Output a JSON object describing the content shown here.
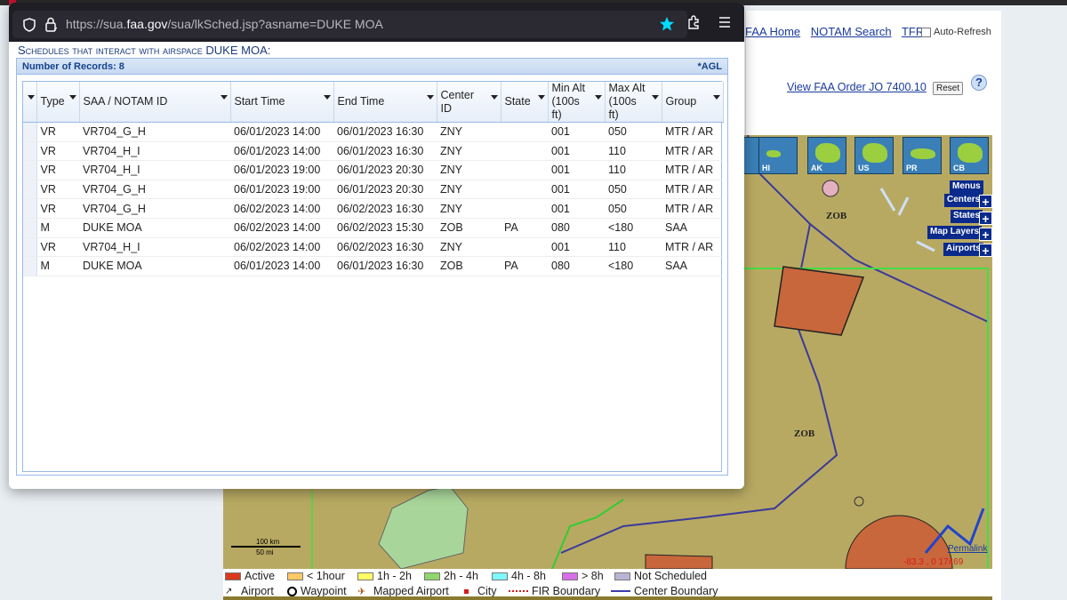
{
  "browser": {
    "url_prefix": "https://sua.",
    "url_domain": "faa.gov",
    "url_suffix": "/sua/lkSched.jsp?asname=DUKE MOA"
  },
  "popup": {
    "heading": "Schedules that interact with airspace DUKE MOA:",
    "record_count_label": "Number of Records: 8",
    "agl_label": "*AGL",
    "columns": [
      "Type",
      "SAA / NOTAM ID",
      "Start Time",
      "End Time",
      "Center ID",
      "State",
      "Min Alt (100s ft)",
      "Max Alt (100s ft)",
      "Group"
    ],
    "rows": [
      [
        "VR",
        "VR704_G_H",
        "06/01/2023 14:00",
        "06/01/2023 16:30",
        "ZNY",
        "",
        "001",
        "050",
        "MTR / AR"
      ],
      [
        "VR",
        "VR704_H_I",
        "06/01/2023 14:00",
        "06/01/2023 16:30",
        "ZNY",
        "",
        "001",
        "110",
        "MTR / AR"
      ],
      [
        "VR",
        "VR704_H_I",
        "06/01/2023 19:00",
        "06/01/2023 20:30",
        "ZNY",
        "",
        "001",
        "110",
        "MTR / AR"
      ],
      [
        "VR",
        "VR704_G_H",
        "06/01/2023 19:00",
        "06/01/2023 20:30",
        "ZNY",
        "",
        "001",
        "050",
        "MTR / AR"
      ],
      [
        "VR",
        "VR704_G_H",
        "06/02/2023 14:00",
        "06/02/2023 16:30",
        "ZNY",
        "",
        "001",
        "050",
        "MTR / AR"
      ],
      [
        "M",
        "DUKE MOA",
        "06/02/2023 14:00",
        "06/02/2023 15:30",
        "ZOB",
        "PA",
        "080",
        "<180",
        "SAA"
      ],
      [
        "VR",
        "VR704_H_I",
        "06/02/2023 14:00",
        "06/02/2023 16:30",
        "ZNY",
        "",
        "001",
        "110",
        "MTR / AR"
      ],
      [
        "M",
        "DUKE MOA",
        "06/01/2023 14:00",
        "06/01/2023 16:30",
        "ZOB",
        "PA",
        "080",
        "<180",
        "SAA"
      ]
    ]
  },
  "background_page": {
    "nav": [
      "FAA Home",
      "NOTAM Search",
      "TFR"
    ],
    "auto_refresh": "Auto-Refresh",
    "view_order": "View FAA Order JO 7400.10",
    "reset": "Reset",
    "help": "?",
    "regions": [
      "HI",
      "AK",
      "US",
      "PR",
      "CB"
    ],
    "side_buttons": [
      "Menus",
      "Centers",
      "States",
      "Map Layers",
      "Airports"
    ],
    "map_labels": [
      "ZOB",
      "ZOB"
    ],
    "permalink": "Permalink",
    "coords": "-83.3  ,  0 17469",
    "scale_km": "100 km",
    "scale_mi": "50 mi",
    "legend": {
      "active": "Active",
      "lt1": "< 1hour",
      "h1_2": "1h - 2h",
      "h2_4": "2h - 4h",
      "h4_8": "4h - 8h",
      "gt8": "> 8h",
      "not_scheduled": "Not Scheduled",
      "airport": "Airport",
      "waypoint": "Waypoint",
      "mapped_airport": "Mapped Airport",
      "city": "City",
      "fir": "FIR Boundary",
      "center": "Center Boundary"
    },
    "colors": {
      "active": "#d93a1a",
      "lt1": "#ffc866",
      "h1_2": "#ffff66",
      "h2_4": "#8fd66b",
      "h4_8": "#7ff7ff",
      "gt8": "#d86ee8",
      "not_scheduled": "#b8b4d6"
    }
  }
}
